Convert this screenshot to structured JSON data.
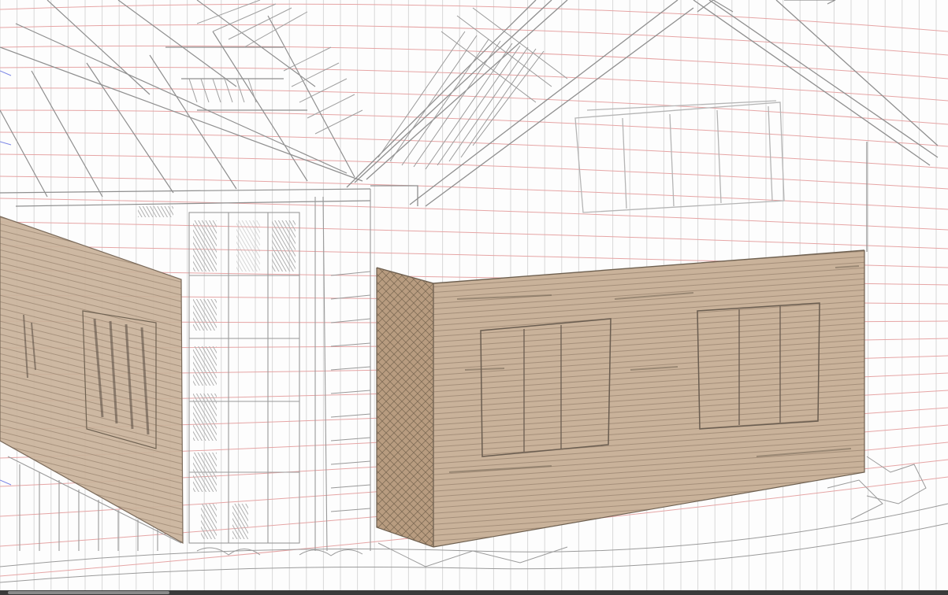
{
  "app": {
    "view": "drawing-canvas"
  },
  "canvas": {
    "background_color": "#fdfdfd",
    "grid_color": "#d8d8d8",
    "perspective_guide_color": "#e8a0a0",
    "blue_guide_color": "#7b86e6",
    "sketch_color": "#8f8f8f",
    "shaded_panel_color": "#c9b29a",
    "shaded_panel_stroke": "#7a6a5a"
  },
  "layers": [
    {
      "name": "perspective-grid",
      "visible": true
    },
    {
      "name": "house-line-sketch",
      "visible": true
    },
    {
      "name": "brown-wall-shading",
      "visible": true
    }
  ],
  "scrollbar": {
    "orientation": "horizontal"
  }
}
